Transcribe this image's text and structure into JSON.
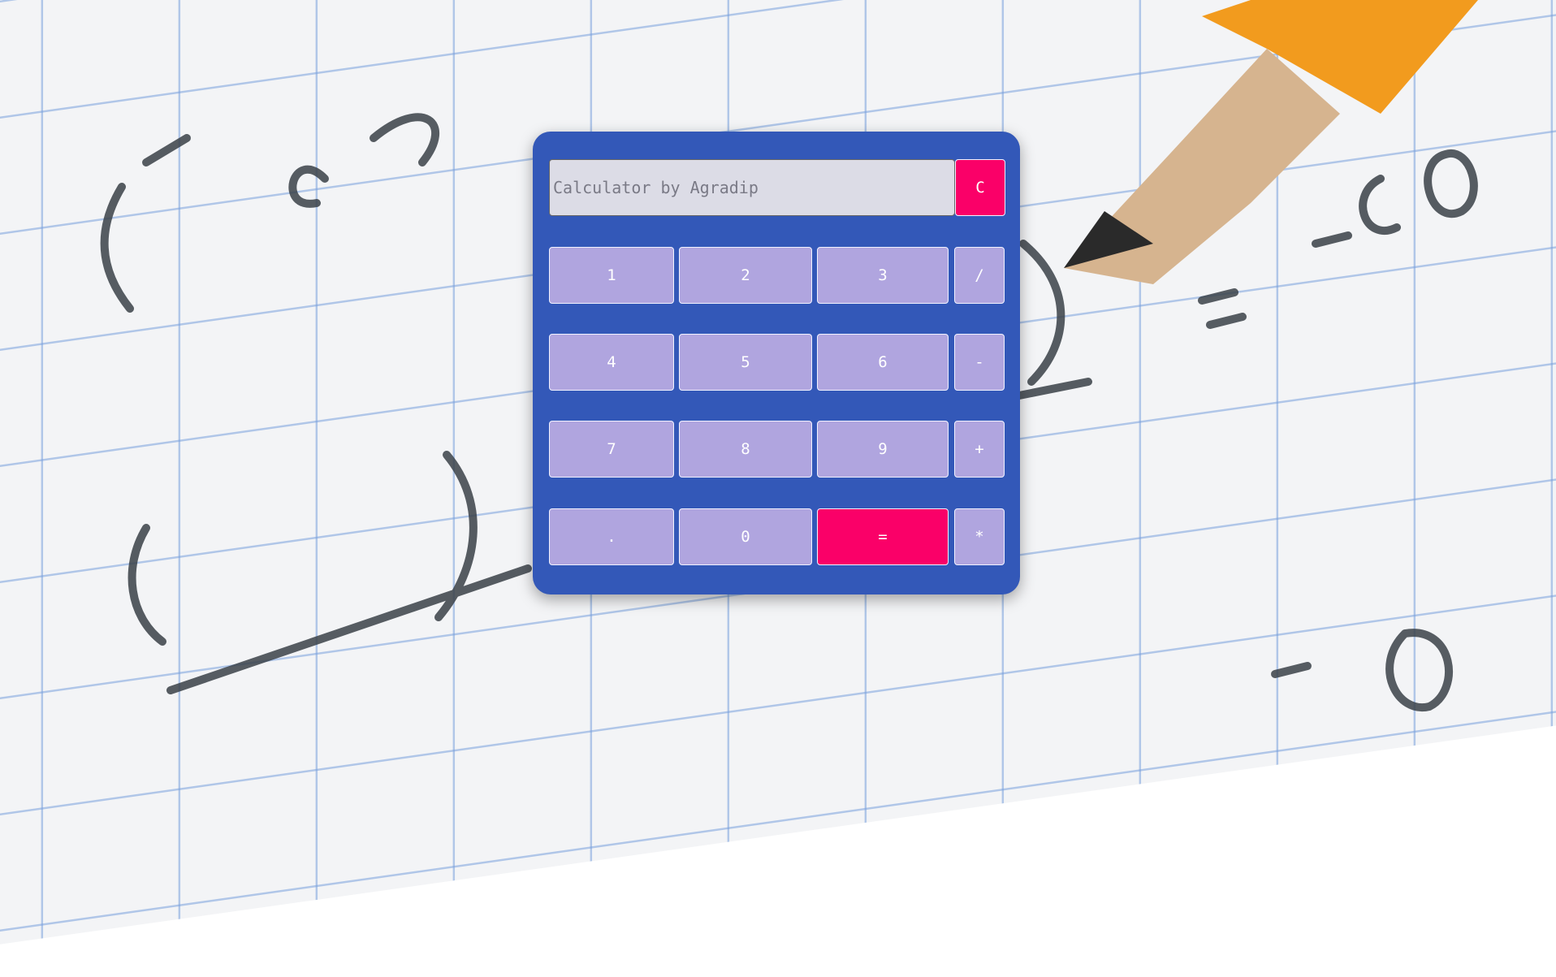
{
  "display": {
    "placeholder": "Calculator by Agradip",
    "value": ""
  },
  "buttons": {
    "clear": "C",
    "one": "1",
    "two": "2",
    "three": "3",
    "divide": "/",
    "four": "4",
    "five": "5",
    "six": "6",
    "minus": "-",
    "seven": "7",
    "eight": "8",
    "nine": "9",
    "plus": "+",
    "dot": ".",
    "zero": "0",
    "equals": "=",
    "multiply": "*"
  },
  "colors": {
    "panel": "#3358b8",
    "key": "#b0a5df",
    "accent": "#fa0068",
    "display": "#dcdce6"
  }
}
